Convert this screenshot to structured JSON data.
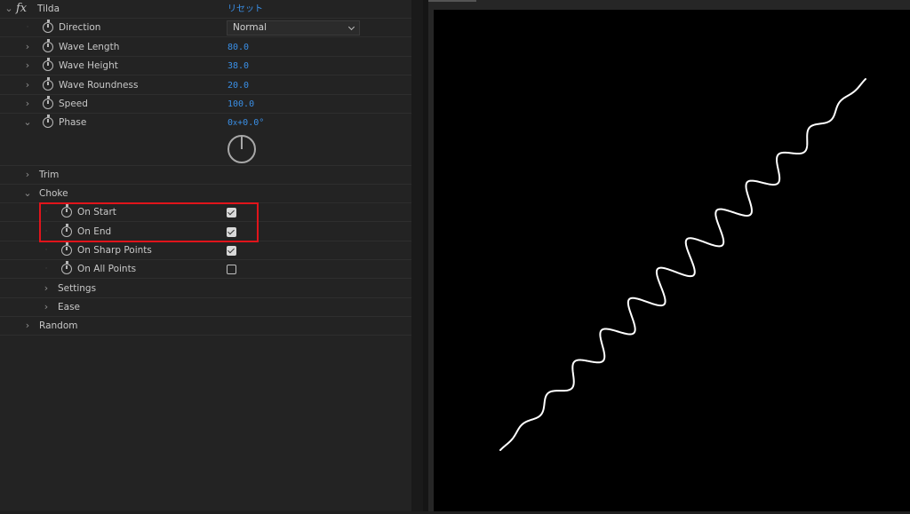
{
  "effect": {
    "name": "Tilda",
    "reset_label": "リセット",
    "fx_icon": "fx-icon"
  },
  "properties": {
    "direction": {
      "label": "Direction",
      "value": "Normal"
    },
    "wave_length": {
      "label": "Wave Length",
      "value": "80.0"
    },
    "wave_height": {
      "label": "Wave Height",
      "value": "38.0"
    },
    "wave_roundness": {
      "label": "Wave Roundness",
      "value": "20.0"
    },
    "speed": {
      "label": "Speed",
      "value": "100.0"
    },
    "phase": {
      "label": "Phase",
      "value_prefix": "0",
      "value_mid": "x",
      "value_suffix": "+0.0°"
    }
  },
  "groups": {
    "trim": "Trim",
    "choke": "Choke",
    "settings": "Settings",
    "ease": "Ease",
    "random": "Random"
  },
  "choke_options": [
    {
      "label": "On Start",
      "checked": true
    },
    {
      "label": "On End",
      "checked": true
    },
    {
      "label": "On Sharp Points",
      "checked": true
    },
    {
      "label": "On All Points",
      "checked": false
    }
  ],
  "colors": {
    "value_blue": "#3a8fe6",
    "highlight_red": "#e0141b",
    "wave_stroke": "#ffffff"
  }
}
